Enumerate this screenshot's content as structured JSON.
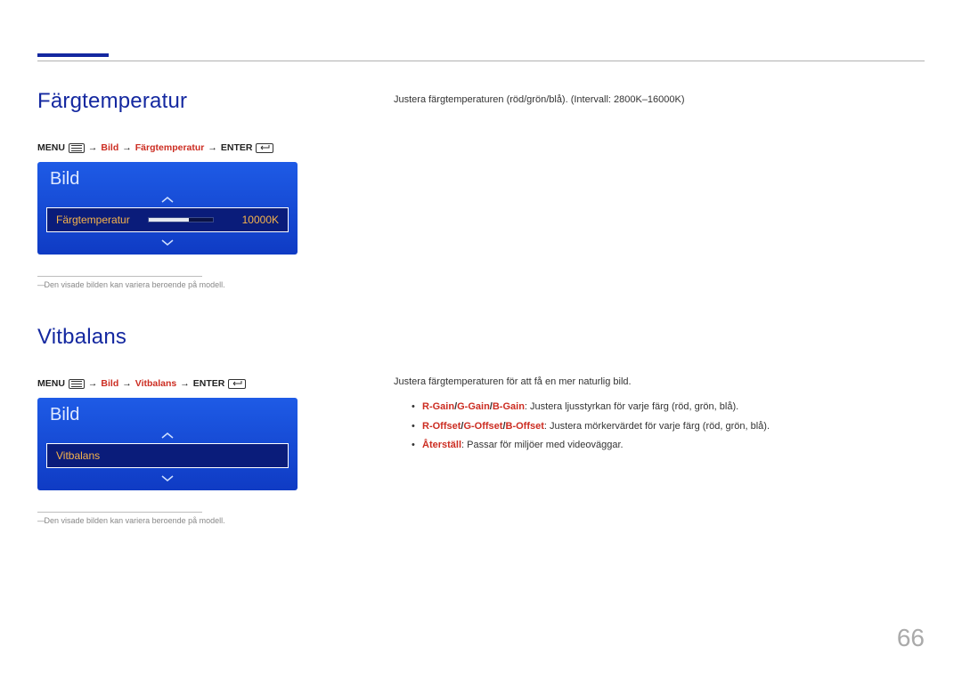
{
  "page_number": "66",
  "section1": {
    "title": "Färgtemperatur",
    "breadcrumb": {
      "menu": "MENU",
      "arrow": "→",
      "p1": "Bild",
      "p2": "Färgtemperatur",
      "enter": "ENTER"
    },
    "osd": {
      "title": "Bild",
      "row_label": "Färgtemperatur",
      "row_value": "10000K"
    },
    "footnote": "Den visade bilden kan variera beroende på modell.",
    "right_text": "Justera färgtemperaturen (röd/grön/blå). (Intervall: 2800K–16000K)"
  },
  "section2": {
    "title": "Vitbalans",
    "breadcrumb": {
      "menu": "MENU",
      "arrow": "→",
      "p1": "Bild",
      "p2": "Vitbalans",
      "enter": "ENTER"
    },
    "osd": {
      "title": "Bild",
      "row_label": "Vitbalans"
    },
    "footnote": "Den visade bilden kan variera beroende på modell.",
    "right_intro": "Justera färgtemperaturen för att få en mer naturlig bild.",
    "bullets": {
      "b1_terms": [
        "R-Gain",
        "G-Gain",
        "B-Gain"
      ],
      "b1_rest": ": Justera ljusstyrkan för varje färg (röd, grön, blå).",
      "b2_terms": [
        "R-Offset",
        "G-Offset",
        "B-Offset"
      ],
      "b2_rest": ": Justera mörkervärdet för varje färg (röd, grön, blå).",
      "b3_term": "Återställ",
      "b3_rest": ": Passar för miljöer med videoväggar."
    }
  }
}
